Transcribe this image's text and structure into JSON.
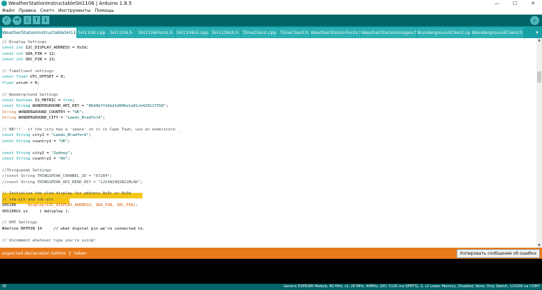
{
  "window": {
    "title": "WeatherStationInstructableSH1106 | Arduino 1.8.5",
    "minimize": "—",
    "maximize": "☐",
    "close": "✕"
  },
  "menu": [
    "Файл",
    "Правка",
    "Скетч",
    "Инструменты",
    "Помощь"
  ],
  "toolbar": {
    "verify": "✓",
    "upload": "→",
    "new": "▯",
    "open": "↑",
    "save": "↓",
    "serial_monitor": "⌕"
  },
  "tabs": [
    "WeatherStationInstructableSH1106 §",
    "SH1106.cpp",
    "SH1106.h",
    "SH1106Fonts.h",
    "SH1106Ui.cpp",
    "SH1106Ui.h",
    "TimeClient.cpp",
    "TimeClient.h",
    "WeatherStationFonts.h",
    "WeatherStationImages.h",
    "WundergroundClient.cpp",
    "WundergroundClient.h"
  ],
  "tab_menu": "▾",
  "code": [
    [
      {
        "t": "// Display Settings",
        "c": "cm"
      }
    ],
    [
      {
        "t": "const int",
        "c": "kw"
      },
      {
        "t": " I2C_DISPLAY_ADDRESS = 0x3d;",
        "c": ""
      }
    ],
    [
      {
        "t": "const int",
        "c": "kw"
      },
      {
        "t": " SDA_PIN = 12;",
        "c": ""
      }
    ],
    [
      {
        "t": "const int",
        "c": "kw"
      },
      {
        "t": " SDC_PIN = 13;",
        "c": ""
      }
    ],
    [],
    [
      {
        "t": "// TimeClient settings",
        "c": "cm"
      }
    ],
    [
      {
        "t": "const float",
        "c": "kw"
      },
      {
        "t": " UTC_OFFSET = 0;",
        "c": ""
      }
    ],
    [
      {
        "t": "float",
        "c": "kw"
      },
      {
        "t": " utcoh = 0;",
        "c": ""
      }
    ],
    [],
    [
      {
        "t": "// Wunderground Settings",
        "c": "cm"
      }
    ],
    [
      {
        "t": "const boolean",
        "c": "kw"
      },
      {
        "t": " IS_METRIC = ",
        "c": ""
      },
      {
        "t": "true",
        "c": "kw"
      },
      {
        "t": ";",
        "c": ""
      }
    ],
    [
      {
        "t": "const String",
        "c": "kw"
      },
      {
        "t": " WUNDERGROUND_API_KEY = ",
        "c": ""
      },
      {
        "t": "\"86d9b7fd1bd1d096e1a01cb429117558\"",
        "c": "str"
      },
      {
        "t": ";",
        "c": ""
      }
    ],
    [
      {
        "t": "String",
        "c": "type"
      },
      {
        "t": " WUNDERGROUND_COUNTRY = ",
        "c": ""
      },
      {
        "t": "\"UK\"",
        "c": "str"
      },
      {
        "t": ";",
        "c": ""
      }
    ],
    [
      {
        "t": "String",
        "c": "type"
      },
      {
        "t": " WUNDERGROUND_CITY = ",
        "c": ""
      },
      {
        "t": "\"Leeds_Bradford\"",
        "c": "str"
      },
      {
        "t": ";",
        "c": ""
      }
    ],
    [],
    [
      {
        "t": "// NB!!! - if the city has a 'space' in it is Cape Town, use an underscore _",
        "c": "cm"
      }
    ],
    [
      {
        "t": "const String",
        "c": "kw"
      },
      {
        "t": " city1 = ",
        "c": ""
      },
      {
        "t": "\"Leeds_Bradford\"",
        "c": "str"
      },
      {
        "t": ";",
        "c": ""
      }
    ],
    [
      {
        "t": "const String",
        "c": "kw"
      },
      {
        "t": " country1 = ",
        "c": ""
      },
      {
        "t": "\"UK\"",
        "c": "str"
      },
      {
        "t": ";",
        "c": ""
      }
    ],
    [],
    [
      {
        "t": "const String",
        "c": "kw"
      },
      {
        "t": " city2 = ",
        "c": ""
      },
      {
        "t": "\"Sydney\"",
        "c": "str"
      },
      {
        "t": ";",
        "c": ""
      }
    ],
    [
      {
        "t": "const String",
        "c": "kw"
      },
      {
        "t": " country2 = ",
        "c": ""
      },
      {
        "t": "\"AU\"",
        "c": "str"
      },
      {
        "t": ";",
        "c": ""
      }
    ],
    [],
    [
      {
        "t": "//Thingspeak Settings",
        "c": "cm"
      }
    ],
    [
      {
        "t": "//const String THINGSPEAK_CHANNEL_ID = \"67284\";",
        "c": "cm"
      }
    ],
    [
      {
        "t": "//const String THINGSPEAK_API_READ_KEY = \"L2VIW20QVNZJBLAK\";",
        "c": "cm"
      }
    ],
    [],
    [
      {
        "t": "// Initialize the oled display for address 0x3c or 0x3d",
        "c": "cm"
      }
    ],
    [
      {
        "t": "// sda-pin and sdc-pin",
        "c": "cm"
      }
    ],
    [
      {
        "t": "SH1106",
        "c": ""
      },
      {
        "t": "     display(I2C_DISPLAY_ADDRESS, SDA_PIN, SDC_PIN);",
        "c": "fn"
      }
    ],
    [
      {
        "t": "SH1106Ui ui     ( &display );",
        "c": ""
      }
    ],
    [],
    [
      {
        "t": "// DHT Settings",
        "c": "cm"
      }
    ],
    [
      {
        "t": "#define DHTPIN 14     // what digital pin we're connected to.",
        "c": ""
      }
    ],
    [],
    [
      {
        "t": "// Uncomment whatever type you're using!",
        "c": "cm"
      }
    ]
  ],
  "error": {
    "message": "expected declaration before '}' token",
    "copy_button": "Копировать сообщение об ошибке"
  },
  "status": {
    "line_number": "30",
    "board": "Generic ESP8266 Module, 80 MHz, ck, 26 MHz, 40MHz, QIO, 512K (no SPIFFS), 2, v2 Lower Memory, Disabled, None, Only Sketch, 115200 на COM7"
  }
}
